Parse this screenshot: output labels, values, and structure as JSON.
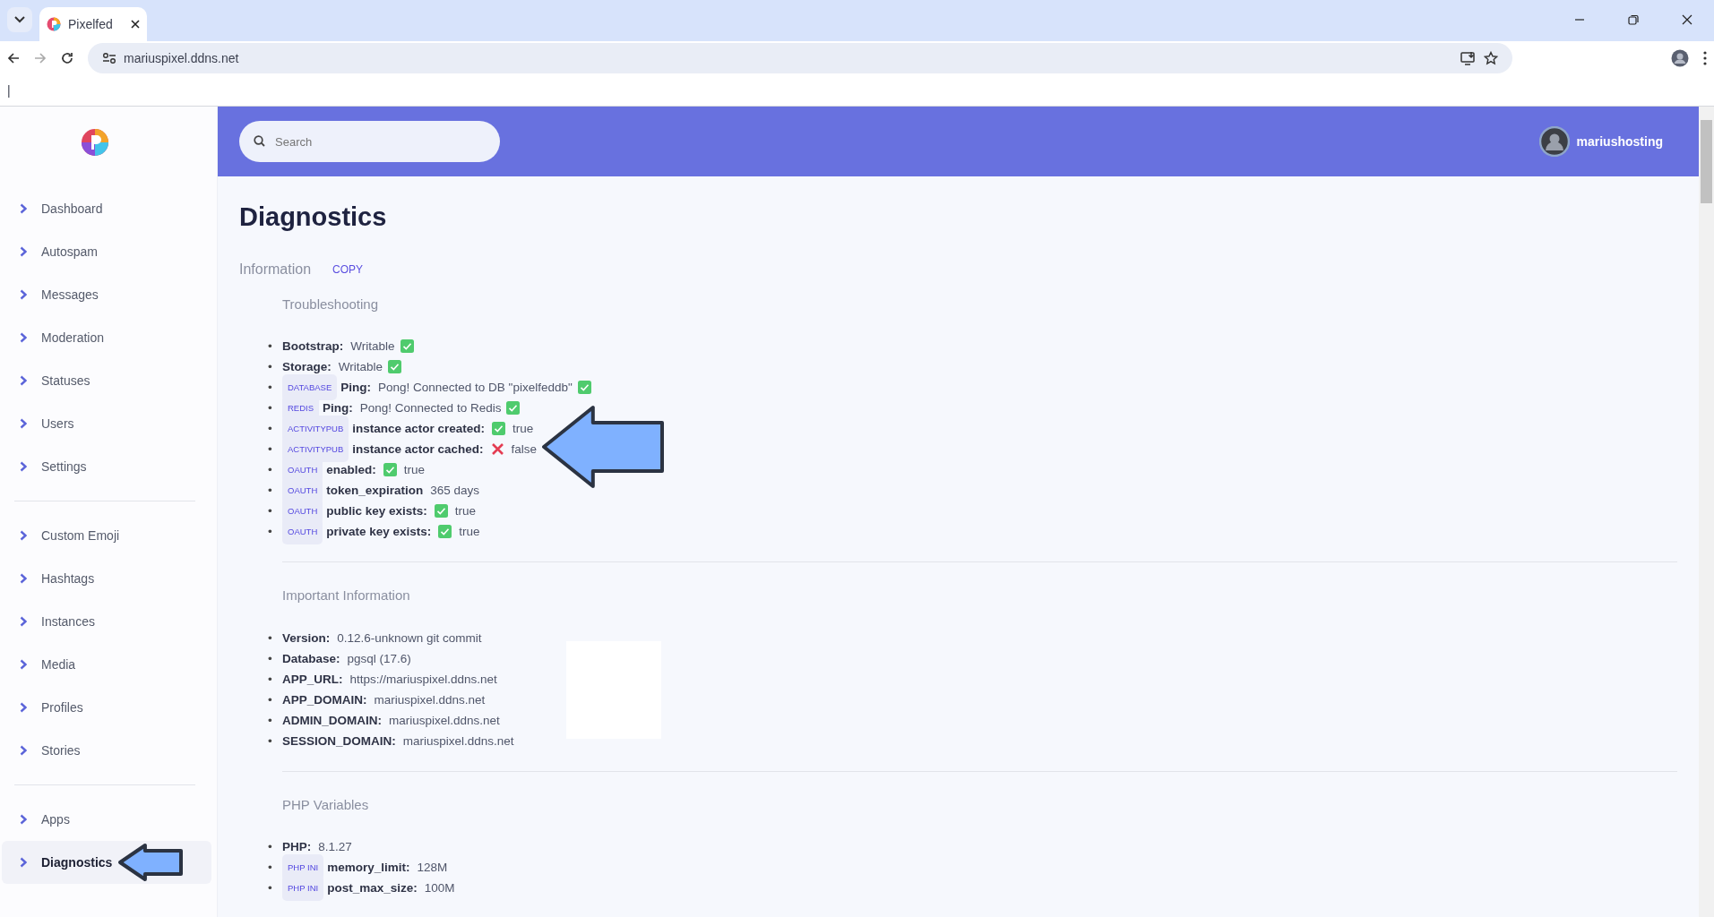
{
  "browser": {
    "tab_title": "Pixelfed",
    "address": "mariuspixel.ddns.net",
    "text_cursor": "|"
  },
  "sidebar": {
    "groups": [
      [
        {
          "label": "Dashboard",
          "selected": false
        },
        {
          "label": "Autospam",
          "selected": false
        },
        {
          "label": "Messages",
          "selected": false
        },
        {
          "label": "Moderation",
          "selected": false
        },
        {
          "label": "Statuses",
          "selected": false
        },
        {
          "label": "Users",
          "selected": false
        },
        {
          "label": "Settings",
          "selected": false
        }
      ],
      [
        {
          "label": "Custom Emoji",
          "selected": false
        },
        {
          "label": "Hashtags",
          "selected": false
        },
        {
          "label": "Instances",
          "selected": false
        },
        {
          "label": "Media",
          "selected": false
        },
        {
          "label": "Profiles",
          "selected": false
        },
        {
          "label": "Stories",
          "selected": false
        }
      ],
      [
        {
          "label": "Apps",
          "selected": false
        },
        {
          "label": "Diagnostics",
          "selected": true,
          "arrow": true
        }
      ]
    ]
  },
  "header": {
    "search": {
      "placeholder": "Search"
    },
    "username": "mariushosting"
  },
  "page": {
    "title": "Diagnostics",
    "section": "Information",
    "copy_button": "COPY",
    "sections": [
      {
        "title": "Troubleshooting",
        "rows": [
          {
            "bullet": "•",
            "label": "Bootstrap:",
            "value": "Writable",
            "passed": true,
            "kind": "value-first"
          },
          {
            "bullet": "•",
            "label": "Storage:",
            "value": "Writable",
            "passed": true,
            "kind": "value-first"
          },
          {
            "bullet": "•",
            "tag": "DATABASE",
            "label": "Ping:",
            "value": "Pong! Connected to DB \"pixelfeddb\"",
            "passed": true,
            "kind": "value-first"
          },
          {
            "bullet": "•",
            "tag": "REDIS",
            "label": "Ping:",
            "value": "Pong! Connected to Redis",
            "passed": true,
            "kind": "value-first"
          },
          {
            "bullet": "•",
            "tag": "ACTIVITYPUB",
            "label": "instance actor created:",
            "value": "true",
            "passed": true,
            "kind": "status-first"
          },
          {
            "bullet": "•",
            "tag": "ACTIVITYPUB",
            "label": "instance actor cached:",
            "value": "false",
            "passed": false,
            "kind": "status-first",
            "arrow": true
          },
          {
            "bullet": "•",
            "tag": "OAUTH",
            "label": "enabled:",
            "value": "true",
            "passed": true,
            "kind": "status-first"
          },
          {
            "bullet": "•",
            "tag": "OAUTH",
            "label": "token_expiration",
            "value": "365 days",
            "kind": "value-first"
          },
          {
            "bullet": "•",
            "tag": "OAUTH",
            "label": "public key exists:",
            "value": "true",
            "passed": true,
            "kind": "status-first"
          },
          {
            "bullet": "•",
            "tag": "OAUTH",
            "label": "private key exists:",
            "value": "true",
            "passed": true,
            "kind": "status-first"
          }
        ]
      },
      {
        "title": "Important Information",
        "blank_panel": true,
        "rows": [
          {
            "bullet": "•",
            "label": "Version:",
            "value": "0.12.6-unknown git commit",
            "kind": "value-first"
          },
          {
            "bullet": "•",
            "label": "Database:",
            "value": "pgsql (17.6)",
            "kind": "value-first"
          },
          {
            "bullet": "•",
            "label": "APP_URL:",
            "value": "https://mariuspixel.ddns.net",
            "kind": "value-first"
          },
          {
            "bullet": "•",
            "label": "APP_DOMAIN:",
            "value": "mariuspixel.ddns.net",
            "kind": "value-first"
          },
          {
            "bullet": "•",
            "label": "ADMIN_DOMAIN:",
            "value": "mariuspixel.ddns.net",
            "kind": "value-first"
          },
          {
            "bullet": "•",
            "label": "SESSION_DOMAIN:",
            "value": "mariuspixel.ddns.net",
            "kind": "value-first"
          }
        ]
      },
      {
        "title": "PHP Variables",
        "rows": [
          {
            "bullet": "•",
            "label": "PHP:",
            "value": "8.1.27",
            "kind": "value-first"
          },
          {
            "bullet": "•",
            "tag": "PHP INI",
            "label": "memory_limit:",
            "value": "128M",
            "kind": "value-first"
          },
          {
            "bullet": "•",
            "tag": "PHP INI",
            "label": "post_max_size:",
            "value": "100M",
            "kind": "value-first"
          }
        ]
      }
    ]
  }
}
